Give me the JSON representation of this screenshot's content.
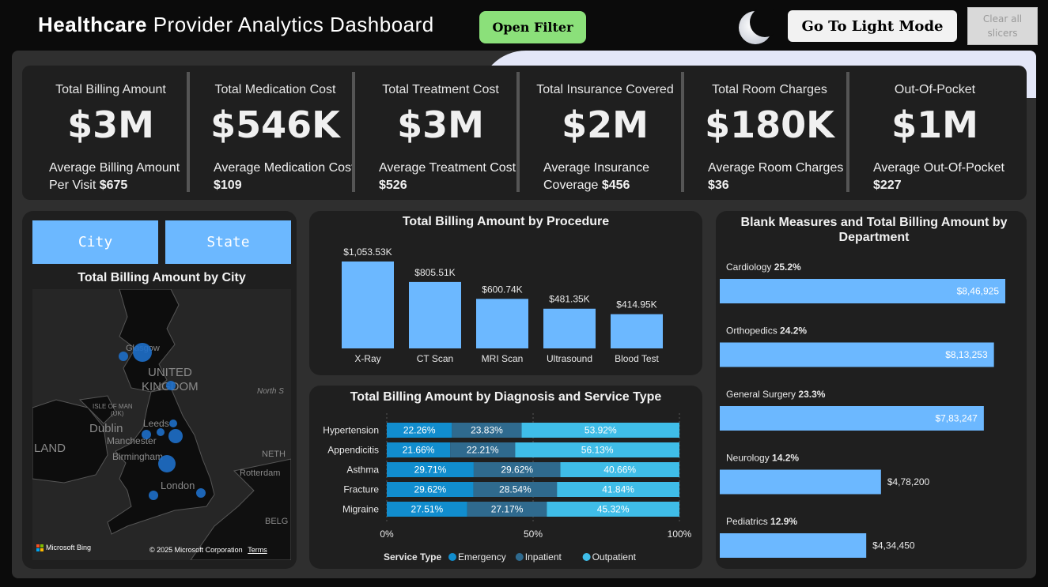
{
  "header": {
    "title_bold": "Healthcare",
    "title_rest": " Provider Analytics Dashboard",
    "open_filter": "Open Filter",
    "light_mode": "Go To Light Mode",
    "clear_slicers": "Clear all slicers"
  },
  "kpis": [
    {
      "title": "Total Billing Amount",
      "value": "$3M",
      "sub_label": "Average Billing Amount Per Visit",
      "sub_value": "$675"
    },
    {
      "title": "Total Medication Cost",
      "value": "$546K",
      "sub_label": "Average Medication Cost",
      "sub_value": "$109"
    },
    {
      "title": "Total Treatment Cost",
      "value": "$3M",
      "sub_label": "Average Treatment Cost",
      "sub_value": "$526"
    },
    {
      "title": "Total Insurance Covered",
      "value": "$2M",
      "sub_label": "Average Insurance Coverage",
      "sub_value": "$456"
    },
    {
      "title": "Total Room Charges",
      "value": "$180K",
      "sub_label": "Average Room Charges",
      "sub_value": "$36"
    },
    {
      "title": "Out-Of-Pocket",
      "value": "$1M",
      "sub_label": "Average Out-Of-Pocket",
      "sub_value": "$227"
    }
  ],
  "map_panel": {
    "city_button": "City",
    "state_button": "State",
    "title": "Total Billing Amount by City",
    "map_labels": [
      "Glasgow",
      "UNITED",
      "KINGDOM",
      "North S",
      "ISLE OF MAN",
      "(UK)",
      "Dublin",
      "Leeds",
      "Manchester",
      "LAND",
      "Birmingham",
      "NETH",
      "Rotterdam",
      "London",
      "BELG"
    ],
    "attribution": "Microsoft Bing",
    "copyright": "© 2025 Microsoft Corporation",
    "terms": "Terms"
  },
  "chart_data": [
    {
      "type": "bar",
      "title": "Total Billing Amount by Procedure",
      "categories": [
        "X-Ray",
        "CT Scan",
        "MRI Scan",
        "Ultrasound",
        "Blood Test"
      ],
      "values": [
        1053.53,
        805.51,
        600.74,
        481.35,
        414.95
      ],
      "data_labels": [
        "$1,053.53K",
        "$805.51K",
        "$600.74K",
        "$481.35K",
        "$414.95K"
      ],
      "color": "#6cb8ff"
    },
    {
      "type": "bar",
      "stacked": "100%",
      "orientation": "horizontal",
      "title": "Total Billing Amount by Diagnosis and Service Type",
      "categories": [
        "Hypertension",
        "Appendicitis",
        "Asthma",
        "Fracture",
        "Migraine"
      ],
      "series": [
        {
          "name": "Emergency",
          "color": "#118dce",
          "values": [
            22.26,
            21.66,
            29.71,
            29.62,
            27.51
          ]
        },
        {
          "name": "Inpatient",
          "color": "#2f6a8e",
          "values": [
            23.83,
            22.21,
            29.62,
            28.54,
            27.17
          ]
        },
        {
          "name": "Outpatient",
          "color": "#3fbde8",
          "values": [
            53.92,
            56.13,
            40.66,
            41.84,
            45.32
          ]
        }
      ],
      "x_ticks": [
        "0%",
        "50%",
        "100%"
      ],
      "legend_title": "Service Type",
      "legend_position": "bottom"
    },
    {
      "type": "bar",
      "orientation": "horizontal",
      "title": "Blank Measures and Total Billing Amount by Department",
      "categories": [
        "Cardiology",
        "Orthopedics",
        "General Surgery",
        "Neurology",
        "Pediatrics"
      ],
      "percents": [
        "25.2%",
        "24.2%",
        "23.3%",
        "14.2%",
        "12.9%"
      ],
      "values": [
        846925,
        813253,
        783247,
        478200,
        434450
      ],
      "data_labels": [
        "$8,46,925",
        "$8,13,253",
        "$7,83,247",
        "$4,78,200",
        "$4,34,450"
      ],
      "color": "#6cb8ff"
    }
  ]
}
